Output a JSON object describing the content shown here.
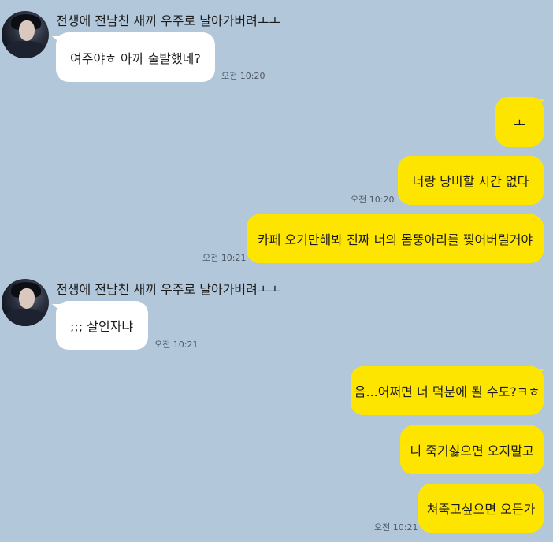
{
  "chat": {
    "sender_name": "전생에 전남친 새끼 우주로 날아가버려ㅗㅗ",
    "messages": [
      {
        "direction": "in",
        "text": "여주야ㅎ 아까 출발했네?",
        "time": "오전 10:20"
      },
      {
        "direction": "out",
        "text": "ㅗ",
        "time": ""
      },
      {
        "direction": "out",
        "text": "너랑 낭비할 시간 없다",
        "time": "오전 10:20"
      },
      {
        "direction": "out",
        "text": "카페 오기만해봐 진짜 너의 몸뚱아리를 찢어버릴거야",
        "time": "오전 10:21"
      },
      {
        "direction": "in",
        "text": ";;; 살인자냐",
        "time": "오전 10:21"
      },
      {
        "direction": "out",
        "text": "음...어쩌면 너 덕분에 될 수도?ㅋㅎ",
        "time": ""
      },
      {
        "direction": "out",
        "text": "니 죽기싫으면 오지말고",
        "time": ""
      },
      {
        "direction": "out",
        "text": "쳐죽고싶으면 오든가",
        "time": "오전 10:21"
      }
    ]
  },
  "colors": {
    "background": "#b2c7da",
    "incoming_bubble": "#ffffff",
    "outgoing_bubble": "#fee500"
  }
}
